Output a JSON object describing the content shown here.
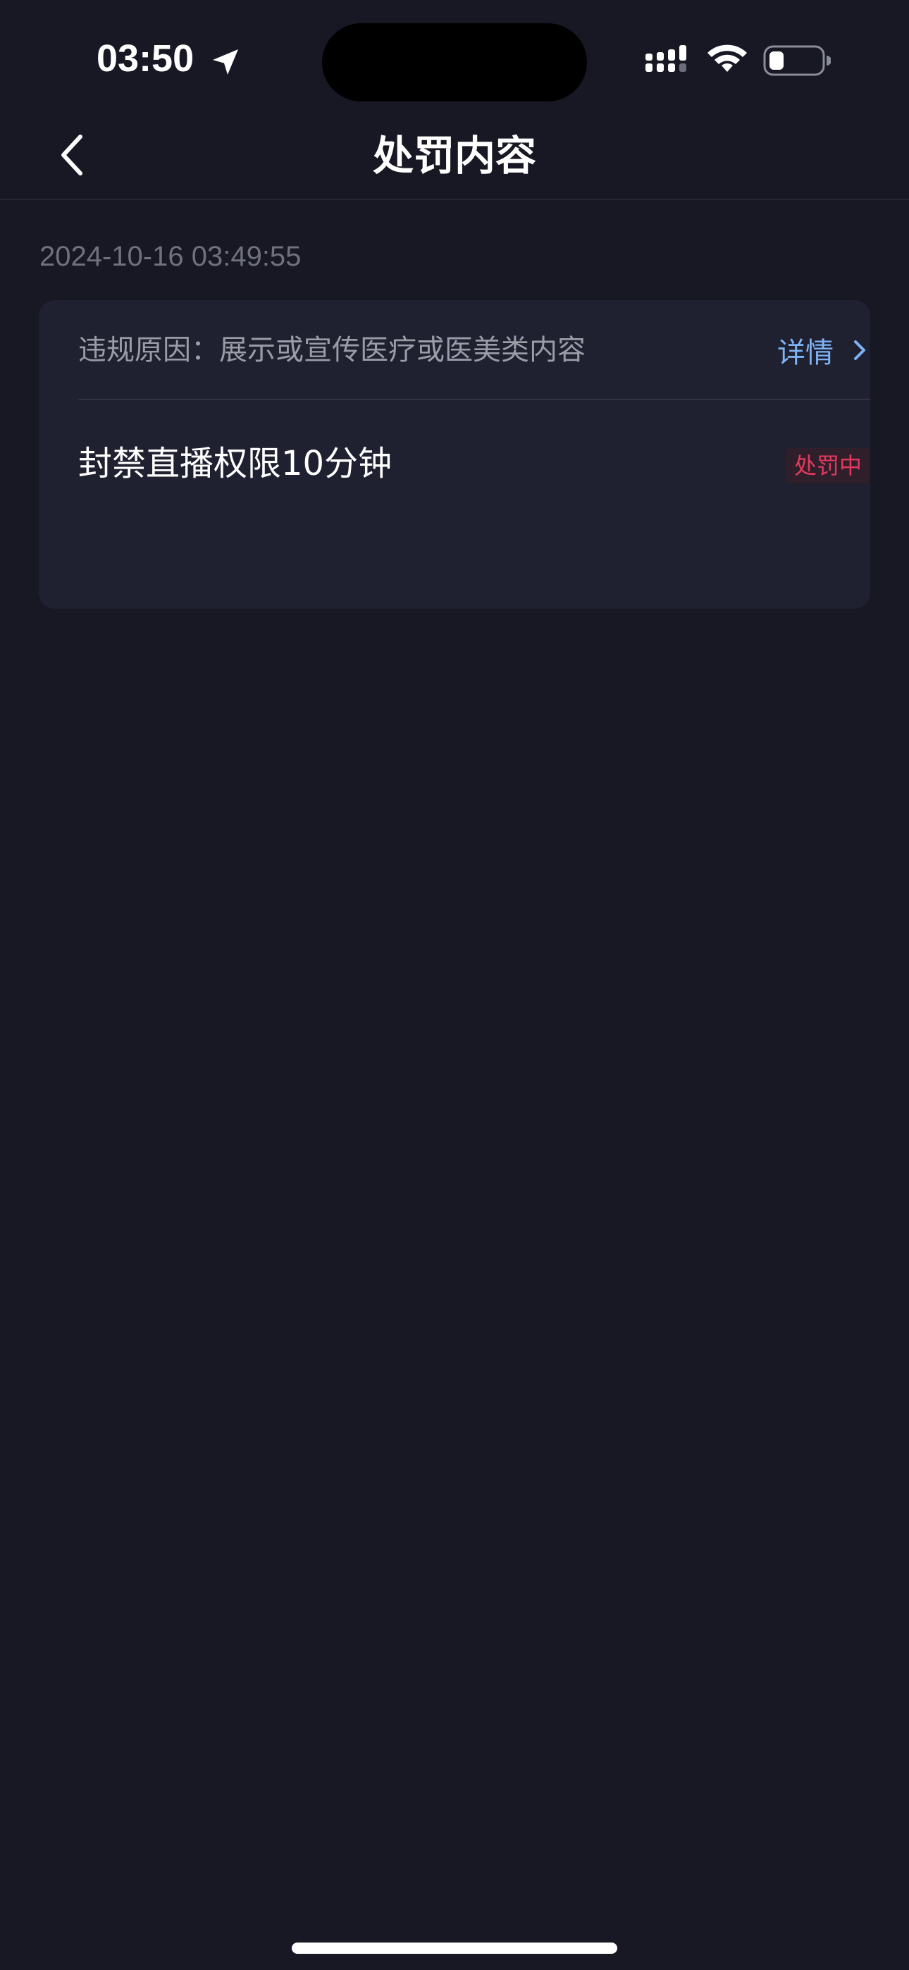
{
  "status_bar": {
    "time": "03:50"
  },
  "nav": {
    "title": "处罚内容"
  },
  "record": {
    "timestamp": "2024-10-16 03:49:55",
    "reason": "违规原因：展示或宣传医疗或医美类内容",
    "detail_label": "详情",
    "penalty": "封禁直播权限10分钟",
    "status": "处罚中"
  },
  "colors": {
    "background": "#171824",
    "card": "#1f2030",
    "link": "#7eb3f4",
    "status_red": "#e6385e"
  },
  "icons": {
    "back": "chevron-left-icon",
    "detail": "chevron-right-icon",
    "location": "location-arrow-icon",
    "signal": "cellular-signal-icon",
    "wifi": "wifi-icon",
    "battery": "battery-icon"
  }
}
